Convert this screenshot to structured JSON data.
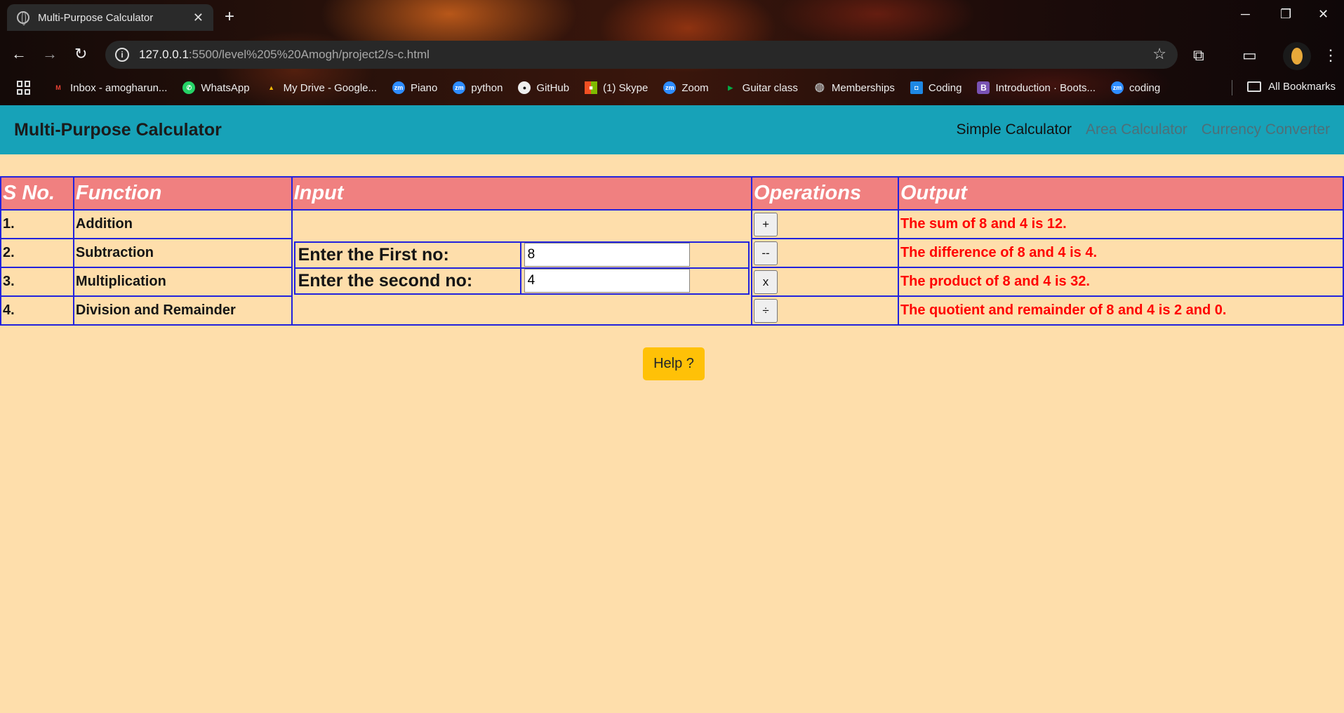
{
  "browser": {
    "tab_title": "Multi-Purpose Calculator",
    "url_host": "127.0.0.1",
    "url_path": ":5500/level%205%20Amogh/project2/s-c.html",
    "bookmarks": [
      {
        "label": "Inbox - amogharun...",
        "icon": "gmail-icon",
        "color": "#ea4335",
        "glyph": "M"
      },
      {
        "label": "WhatsApp",
        "icon": "whatsapp-icon",
        "color": "#25d366",
        "glyph": "✆"
      },
      {
        "label": "My Drive - Google...",
        "icon": "google-drive-icon",
        "color": "#fbbc04",
        "glyph": "▲"
      },
      {
        "label": "Piano",
        "icon": "zoom-icon",
        "color": "#2d8cff",
        "glyph": "zm"
      },
      {
        "label": "python",
        "icon": "zoom-icon",
        "color": "#2d8cff",
        "glyph": "zm"
      },
      {
        "label": "GitHub",
        "icon": "github-icon",
        "color": "#333333",
        "glyph": "●"
      },
      {
        "label": "(1) Skype",
        "icon": "microsoft-icon",
        "color": "#f25022",
        "glyph": "■"
      },
      {
        "label": "Zoom",
        "icon": "zoom-icon",
        "color": "#2d8cff",
        "glyph": "zm"
      },
      {
        "label": "Guitar class",
        "icon": "google-meet-icon",
        "color": "#00897b",
        "glyph": "▶"
      },
      {
        "label": "Memberships",
        "icon": "globe-icon",
        "color": "#777777",
        "glyph": "◍"
      },
      {
        "label": "Coding",
        "icon": "google-classroom-icon",
        "color": "#1e88e5",
        "glyph": "◘"
      },
      {
        "label": "Introduction · Boots...",
        "icon": "bootstrap-icon",
        "color": "#7952b3",
        "glyph": "B"
      },
      {
        "label": "coding",
        "icon": "zoom-icon",
        "color": "#2d8cff",
        "glyph": "zm"
      }
    ],
    "all_bookmarks": "All Bookmarks"
  },
  "navbar": {
    "brand": "Multi-Purpose Calculator",
    "links": [
      "Simple Calculator",
      "Area Calculator",
      "Currency Converter"
    ]
  },
  "table": {
    "headers": [
      "S No.",
      "Function",
      "Input",
      "Operations",
      "Output"
    ],
    "rows": [
      {
        "sno": "1.",
        "function": "Addition",
        "op": "+",
        "output": "The sum of 8 and 4 is 12."
      },
      {
        "sno": "2.",
        "function": "Subtraction",
        "op": "--",
        "output": "The difference of 8 and 4 is 4."
      },
      {
        "sno": "3.",
        "function": "Multiplication",
        "op": "x",
        "output": "The product of 8 and 4 is 32."
      },
      {
        "sno": "4.",
        "function": "Division and Remainder",
        "op": "÷",
        "output": "The quotient and remainder of 8 and 4 is 2 and 0."
      }
    ],
    "input": {
      "first_label": "Enter the First no:",
      "first_value": "8",
      "second_label": "Enter the second no:",
      "second_value": "4"
    }
  },
  "help_button": "Help ?",
  "colors": {
    "page_bg": "#fedeab",
    "navbar_bg": "#17a2b8",
    "header_bg": "#f08080",
    "border": "#2222dd",
    "output_text": "#ff0000",
    "help_bg": "#ffc107"
  }
}
